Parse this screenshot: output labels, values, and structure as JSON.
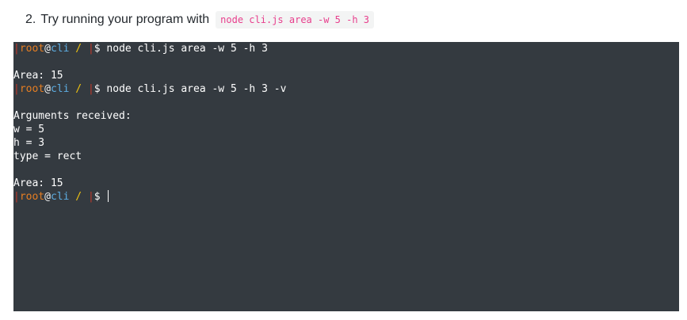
{
  "instruction": {
    "number": "2.",
    "text": "Try running your program with",
    "code": "node cli.js area -w 5 -h 3"
  },
  "prompt": {
    "bar": "|",
    "user": "root",
    "at": "@",
    "host": "cli",
    "path": "/",
    "sep": "|",
    "dollar": "$"
  },
  "terminal": {
    "cmd1": "node cli.js area -w 5 -h 3",
    "out1": "Area: 15",
    "cmd2": "node cli.js area -w 5 -h 3 -v",
    "out2_header": "Arguments received:",
    "out2_w": "w = 5",
    "out2_h": "h = 3",
    "out2_type": "type = rect",
    "out2_area": "Area: 15"
  },
  "colors": {
    "terminal_bg": "#343a40",
    "code_pink": "#e83e8c",
    "prompt_user": "#e67e22",
    "prompt_host": "#5dade2",
    "prompt_path": "#f1c40f",
    "prompt_bar": "#c0392b"
  }
}
